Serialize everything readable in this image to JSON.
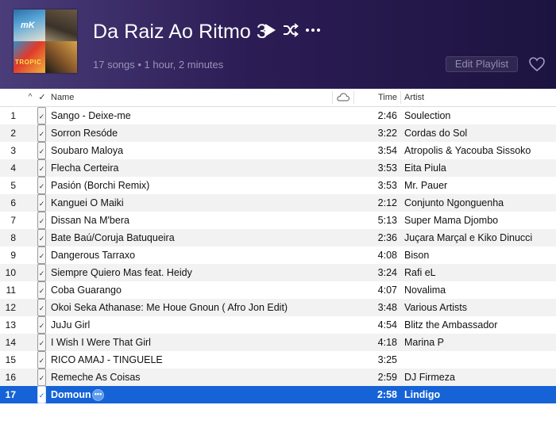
{
  "header": {
    "title": "Da Raiz Ao Ritmo 3",
    "meta": "17 songs • 1 hour, 2 minutes",
    "edit_label": "Edit Playlist",
    "artwork_text_a": "mK",
    "artwork_text_c": "TROPIC",
    "play_icon": "play-icon",
    "shuffle_icon": "shuffle-icon",
    "more_icon": "more-icon",
    "heart_icon": "heart-icon"
  },
  "columns": {
    "sort": "^",
    "check": "✓",
    "name": "Name",
    "cloud_icon": "cloud-icon",
    "time": "Time",
    "artist": "Artist"
  },
  "tracks": [
    {
      "num": "1",
      "name": "Sango - Deixe-me",
      "time": "2:46",
      "artist": "Soulection"
    },
    {
      "num": "2",
      "name": "Sorron Resóde",
      "time": "3:22",
      "artist": "Cordas do Sol"
    },
    {
      "num": "3",
      "name": "Soubaro Maloya",
      "time": "3:54",
      "artist": "Atropolis & Yacouba Sissoko"
    },
    {
      "num": "4",
      "name": "Flecha Certeira",
      "time": "3:53",
      "artist": "Eita Piula"
    },
    {
      "num": "5",
      "name": "Pasión (Borchi Remix)",
      "time": "3:53",
      "artist": "Mr. Pauer"
    },
    {
      "num": "6",
      "name": "Kanguei O Maiki",
      "time": "2:12",
      "artist": "Conjunto Ngonguenha"
    },
    {
      "num": "7",
      "name": "Dissan Na M'bera",
      "time": "5:13",
      "artist": "Super Mama Djombo"
    },
    {
      "num": "8",
      "name": "Bate Baú/Coruja Batuqueira",
      "time": "2:36",
      "artist": "Juçara Marçal e Kiko Dinucci"
    },
    {
      "num": "9",
      "name": "Dangerous Tarraxo",
      "time": "4:08",
      "artist": "Bison"
    },
    {
      "num": "10",
      "name": "Siempre Quiero Mas feat. Heidy",
      "time": "3:24",
      "artist": "Rafi eL"
    },
    {
      "num": "11",
      "name": "Coba Guarango",
      "time": "4:07",
      "artist": "Novalima"
    },
    {
      "num": "12",
      "name": "Okoi Seka Athanase: Me Houe Gnoun ( Afro Jon Edit)",
      "time": "3:48",
      "artist": "Various Artists"
    },
    {
      "num": "13",
      "name": "JuJu Girl",
      "time": "4:54",
      "artist": "Blitz the Ambassador"
    },
    {
      "num": "14",
      "name": "I Wish I Were That Girl",
      "time": "4:18",
      "artist": "Marina P"
    },
    {
      "num": "15",
      "name": "RICO AMAJ -  TINGUELE",
      "time": "3:25",
      "artist": ""
    },
    {
      "num": "16",
      "name": "Remeche As Coisas",
      "time": "2:59",
      "artist": "DJ Firmeza"
    },
    {
      "num": "17",
      "name": "Domoun",
      "time": "2:58",
      "artist": "Lindigo"
    }
  ],
  "selected_index": 16,
  "row_more_label": "•••",
  "colors": {
    "selection": "#1563d6",
    "header_bg": "#2c1c55"
  }
}
